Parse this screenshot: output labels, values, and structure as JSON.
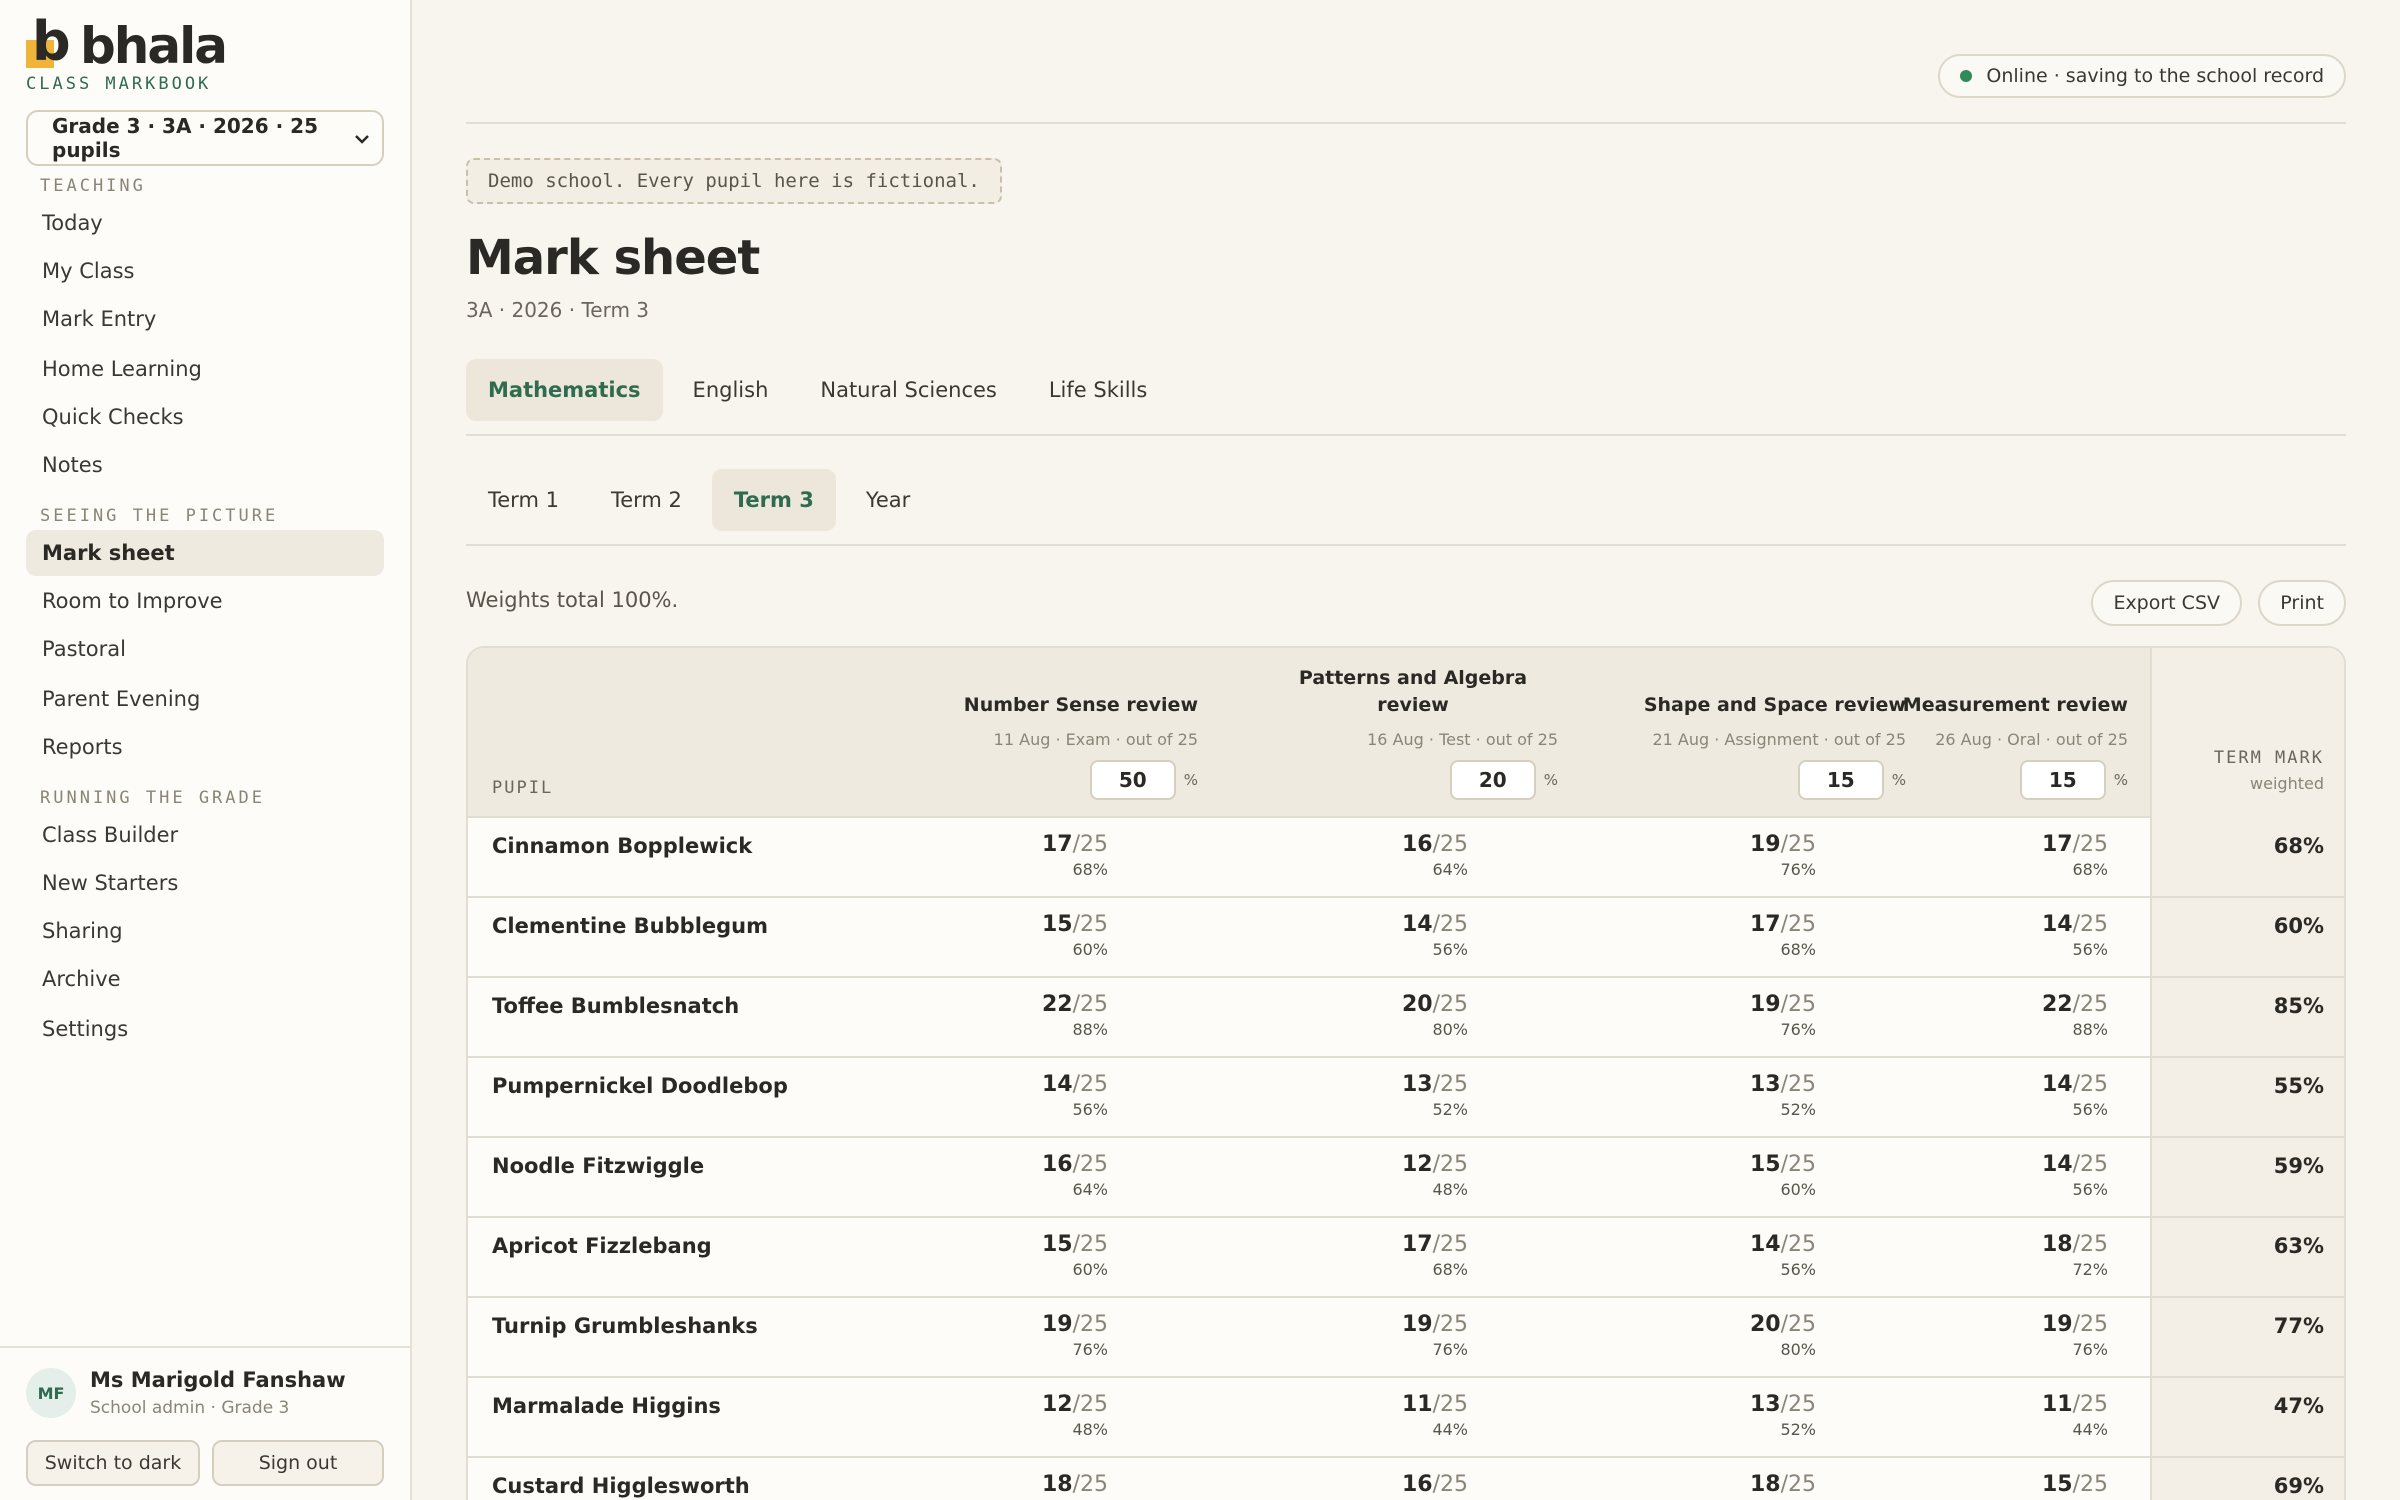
{
  "brand": {
    "name": "bhala",
    "logo_letter": "b",
    "subtitle": "CLASS MARKBOOK"
  },
  "class_selector": {
    "value": "Grade 3 · 3A · 2026 · 25 pupils"
  },
  "nav": {
    "sections": [
      {
        "label": "TEACHING",
        "items": [
          "Today",
          "My Class",
          "Mark Entry",
          "Home Learning",
          "Quick Checks",
          "Notes"
        ]
      },
      {
        "label": "SEEING THE PICTURE",
        "items": [
          "Mark sheet",
          "Room to Improve",
          "Pastoral",
          "Parent Evening",
          "Reports"
        ]
      },
      {
        "label": "RUNNING THE GRADE",
        "items": [
          "Class Builder",
          "New Starters",
          "Sharing",
          "Archive",
          "Settings"
        ]
      }
    ],
    "active": "Mark sheet"
  },
  "user": {
    "initials": "MF",
    "name": "Ms Marigold Fanshaw",
    "role": "School admin · Grade 3",
    "theme_button": "Switch to dark",
    "signout_button": "Sign out"
  },
  "status": {
    "text": "Online · saving to the school record",
    "color": "#2f8a59"
  },
  "demo_note": "Demo school. Every pupil here is fictional.",
  "page": {
    "title": "Mark sheet",
    "subtitle": "3A · 2026 · Term 3"
  },
  "subject_tabs": {
    "items": [
      "Mathematics",
      "English",
      "Natural Sciences",
      "Life Skills"
    ],
    "active": "Mathematics"
  },
  "term_tabs": {
    "items": [
      "Term 1",
      "Term 2",
      "Term 3",
      "Year"
    ],
    "active": "Term 3"
  },
  "weights_note": "Weights total 100%.",
  "actions": {
    "export": "Export CSV",
    "print": "Print"
  },
  "table": {
    "pupil_header": "PUPIL",
    "term_header": "TERM MARK",
    "term_subheader": "weighted",
    "pct_sign": "%",
    "assessments": [
      {
        "title_lines": [
          "Number Sense review"
        ],
        "meta": "11 Aug · Exam · out of 25",
        "weight": "50"
      },
      {
        "title_lines": [
          "Patterns and Algebra",
          "review"
        ],
        "meta": "16 Aug · Test · out of 25",
        "weight": "20"
      },
      {
        "title_lines": [
          "Shape and Space review"
        ],
        "meta": "21 Aug · Assignment · out of 25",
        "weight": "15"
      },
      {
        "title_lines": [
          "Measurement review"
        ],
        "meta": "26 Aug · Oral · out of 25",
        "weight": "15"
      }
    ],
    "out_of": "/25",
    "rows": [
      {
        "name": "Cinnamon Bopplewick",
        "marks": [
          {
            "s": "17",
            "p": "68%"
          },
          {
            "s": "16",
            "p": "64%"
          },
          {
            "s": "19",
            "p": "76%"
          },
          {
            "s": "17",
            "p": "68%"
          }
        ],
        "term": "68%"
      },
      {
        "name": "Clementine Bubblegum",
        "marks": [
          {
            "s": "15",
            "p": "60%"
          },
          {
            "s": "14",
            "p": "56%"
          },
          {
            "s": "17",
            "p": "68%"
          },
          {
            "s": "14",
            "p": "56%"
          }
        ],
        "term": "60%"
      },
      {
        "name": "Toffee Bumblesnatch",
        "marks": [
          {
            "s": "22",
            "p": "88%"
          },
          {
            "s": "20",
            "p": "80%"
          },
          {
            "s": "19",
            "p": "76%"
          },
          {
            "s": "22",
            "p": "88%"
          }
        ],
        "term": "85%"
      },
      {
        "name": "Pumpernickel Doodlebop",
        "marks": [
          {
            "s": "14",
            "p": "56%"
          },
          {
            "s": "13",
            "p": "52%"
          },
          {
            "s": "13",
            "p": "52%"
          },
          {
            "s": "14",
            "p": "56%"
          }
        ],
        "term": "55%"
      },
      {
        "name": "Noodle Fitzwiggle",
        "marks": [
          {
            "s": "16",
            "p": "64%"
          },
          {
            "s": "12",
            "p": "48%"
          },
          {
            "s": "15",
            "p": "60%"
          },
          {
            "s": "14",
            "p": "56%"
          }
        ],
        "term": "59%"
      },
      {
        "name": "Apricot Fizzlebang",
        "marks": [
          {
            "s": "15",
            "p": "60%"
          },
          {
            "s": "17",
            "p": "68%"
          },
          {
            "s": "14",
            "p": "56%"
          },
          {
            "s": "18",
            "p": "72%"
          }
        ],
        "term": "63%"
      },
      {
        "name": "Turnip Grumbleshanks",
        "marks": [
          {
            "s": "19",
            "p": "76%"
          },
          {
            "s": "19",
            "p": "76%"
          },
          {
            "s": "20",
            "p": "80%"
          },
          {
            "s": "19",
            "p": "76%"
          }
        ],
        "term": "77%"
      },
      {
        "name": "Marmalade Higgins",
        "marks": [
          {
            "s": "12",
            "p": "48%"
          },
          {
            "s": "11",
            "p": "44%"
          },
          {
            "s": "13",
            "p": "52%"
          },
          {
            "s": "11",
            "p": "44%"
          }
        ],
        "term": "47%"
      },
      {
        "name": "Custard Higglesworth",
        "marks": [
          {
            "s": "18",
            "p": ""
          },
          {
            "s": "16",
            "p": ""
          },
          {
            "s": "18",
            "p": ""
          },
          {
            "s": "15",
            "p": ""
          }
        ],
        "term": "69%"
      }
    ]
  },
  "colors": {
    "accent_green": "#2f6b4f",
    "brand_yellow": "#f0b43b",
    "background": "#f8f5ee"
  }
}
